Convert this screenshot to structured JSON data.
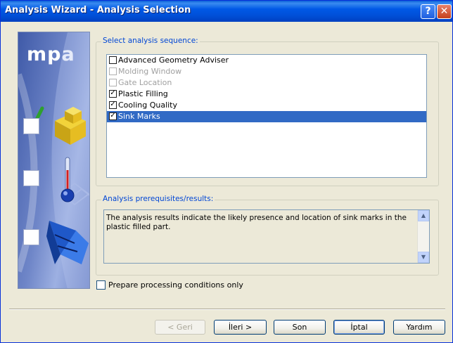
{
  "window": {
    "title": "Analysis Wizard - Analysis Selection",
    "help_glyph": "?",
    "close_glyph": "✕"
  },
  "sidebar": {
    "logo": "mpa",
    "steps": [
      {
        "icon": "part-geometry-icon",
        "checked": true
      },
      {
        "icon": "thermometer-icon",
        "checked": false
      },
      {
        "icon": "mold-tool-icon",
        "checked": false
      }
    ]
  },
  "sequence": {
    "legend": "Select analysis sequence:",
    "items": [
      {
        "label": "Advanced Geometry Adviser",
        "checked": false,
        "enabled": true,
        "selected": false
      },
      {
        "label": "Molding Window",
        "checked": false,
        "enabled": false,
        "selected": false
      },
      {
        "label": "Gate Location",
        "checked": false,
        "enabled": false,
        "selected": false
      },
      {
        "label": "Plastic Filling",
        "checked": true,
        "enabled": true,
        "selected": false
      },
      {
        "label": "Cooling Quality",
        "checked": true,
        "enabled": true,
        "selected": false
      },
      {
        "label": "Sink Marks",
        "checked": true,
        "enabled": true,
        "selected": true
      }
    ]
  },
  "results": {
    "legend": "Analysis prerequisites/results:",
    "text": "The analysis results indicate the likely presence and location of sink marks in the plastic filled part."
  },
  "prepare": {
    "label": "Prepare processing conditions only",
    "checked": false
  },
  "buttons": {
    "back": "< Geri",
    "next": "İleri >",
    "finish": "Son",
    "cancel": "İptal",
    "help": "Yardım"
  },
  "colors": {
    "title_bar": "#0058e6",
    "selection": "#316ac5",
    "group_legend": "#0046d5"
  }
}
